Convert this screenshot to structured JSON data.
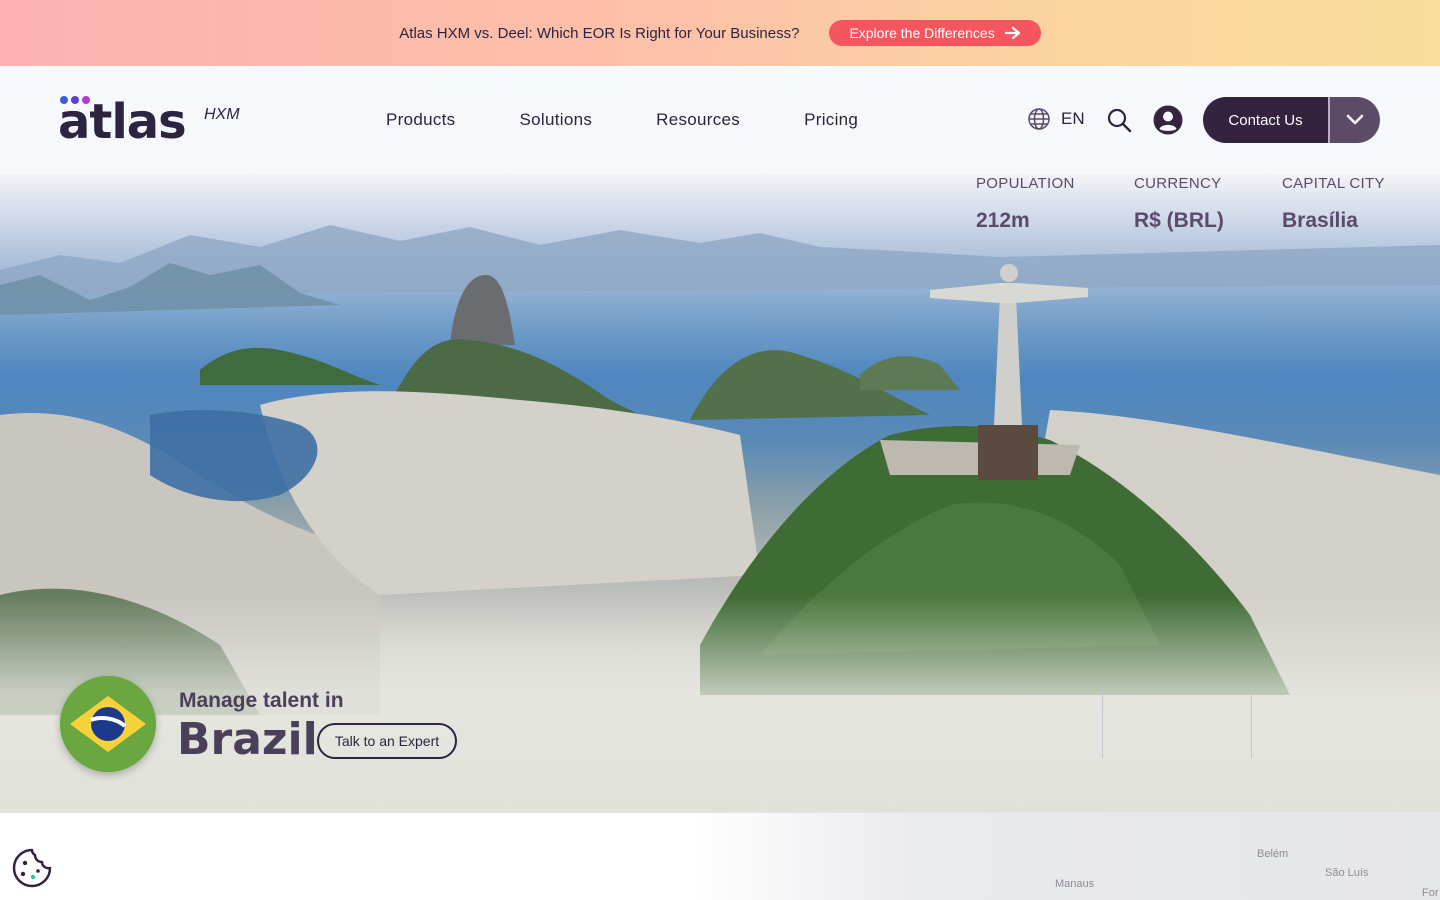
{
  "promo": {
    "text": "Atlas HXM vs. Deel: Which EOR Is Right for Your Business?",
    "button_label": "Explore the Differences"
  },
  "header": {
    "logo_word": "atlas",
    "logo_suffix": "HXM",
    "nav": [
      "Products",
      "Solutions",
      "Resources",
      "Pricing"
    ],
    "language": "EN",
    "contact_label": "Contact Us"
  },
  "hero": {
    "kicker": "Manage talent in",
    "country": "Brazil",
    "cta_label": "Talk to an Expert",
    "stats": [
      {
        "label": "POPULATION",
        "value": "212m"
      },
      {
        "label": "CURRENCY",
        "value": "R$ (BRL)"
      },
      {
        "label": "CAPITAL CITY",
        "value": "Brasília"
      }
    ]
  },
  "map": {
    "labels": [
      "Belém",
      "São Luís",
      "Manaus",
      "For"
    ]
  },
  "colors": {
    "brand_dark": "#33233f",
    "promo_button": "#f4555f",
    "logo_dots": [
      "#3b5bdb",
      "#5b3fd6",
      "#b13ad1"
    ]
  }
}
